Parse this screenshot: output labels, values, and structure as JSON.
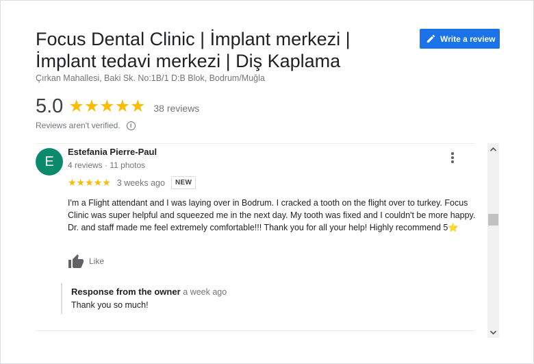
{
  "place": {
    "name": "Focus Dental Clinic | İmplant merkezi | İmplant tedavi merkezi | Diş Kaplama",
    "address": "Çırkan Mahallesi, Baki Sk. No:1B/1 D:B Blok, Bodrum/Muğla"
  },
  "actions": {
    "write_review_label": "Write a review",
    "write_review_icon": "pencil-icon"
  },
  "rating": {
    "value": "5.0",
    "stars": "★★★★★",
    "star_count": 5,
    "review_count": "38 reviews",
    "verified_note": "Reviews aren't verified.",
    "info_icon": "i"
  },
  "colors": {
    "accent": "#1a73e8",
    "star": "#fbbc04",
    "avatar": "#0b8a6c"
  },
  "review": {
    "avatar_letter": "E",
    "author": "Estefania Pierre-Paul",
    "author_meta": "4 reviews · 11 photos",
    "stars": "★★★★★",
    "star_count": 5,
    "time_ago": "3 weeks ago",
    "badge": "NEW",
    "text": "I'm a Flight attendant and I was laying over in Bodrum. I cracked a tooth on the flight over to turkey. Focus Clinic was super helpful and squeezed me in the next day.  My tooth was fixed and I couldn't be more happy. Dr. and staff made me feel extremely comfortable!!! Thank you for all your help! Highly recommend 5⭐",
    "like_label": "Like",
    "like_icon": "thumbs-up-icon",
    "more_icon": "more-vert-icon",
    "response": {
      "owner_label": "Response from the owner",
      "time_ago": "a week ago",
      "text": "Thank you so much!"
    }
  }
}
